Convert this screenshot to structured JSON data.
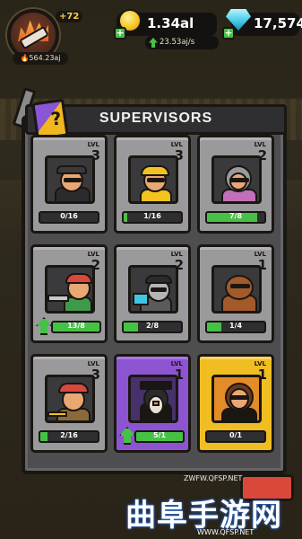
{
  "hud": {
    "level_bonus": "+72",
    "idle_earnings": "564.23aj",
    "cash": "1.34al",
    "cash_rate": "23.53aj/s",
    "gems": "17,574"
  },
  "panel": {
    "title": "SUPERVISORS",
    "badge": "?",
    "level_label": "LVL"
  },
  "cards": [
    {
      "level": "3",
      "progress": "0/16",
      "fill": 0.0,
      "tier": "gray",
      "can_upgrade": false,
      "icon": "supervisor-miner-icon"
    },
    {
      "level": "3",
      "progress": "1/16",
      "fill": 0.0625,
      "tier": "gray",
      "can_upgrade": false,
      "icon": "supervisor-hardhat-icon"
    },
    {
      "level": "2",
      "progress": "7/8",
      "fill": 0.875,
      "tier": "gray",
      "can_upgrade": false,
      "icon": "supervisor-granny-icon"
    },
    {
      "level": "2",
      "progress": "13/8",
      "fill": 1.0,
      "tier": "gray",
      "can_upgrade": true,
      "icon": "supervisor-chainsaw-icon"
    },
    {
      "level": "2",
      "progress": "2/8",
      "fill": 0.25,
      "tier": "gray",
      "can_upgrade": false,
      "icon": "supervisor-hacker-icon"
    },
    {
      "level": "1",
      "progress": "1/4",
      "fill": 0.25,
      "tier": "gray",
      "can_upgrade": false,
      "icon": "supervisor-bear-icon"
    },
    {
      "level": "3",
      "progress": "2/16",
      "fill": 0.125,
      "tier": "gray",
      "can_upgrade": false,
      "icon": "supervisor-pirate-icon"
    },
    {
      "level": "1",
      "progress": "5/1",
      "fill": 1.0,
      "tier": "purple",
      "can_upgrade": true,
      "icon": "supervisor-penguin-icon"
    },
    {
      "level": "1",
      "progress": "0/1",
      "fill": 0.0,
      "tier": "gold",
      "can_upgrade": false,
      "icon": "supervisor-agent-icon"
    }
  ],
  "watermark": {
    "site": "ZWFW.QFSP.NET",
    "title": "曲阜手游网",
    "url": "WWW.QFSP.NET"
  }
}
